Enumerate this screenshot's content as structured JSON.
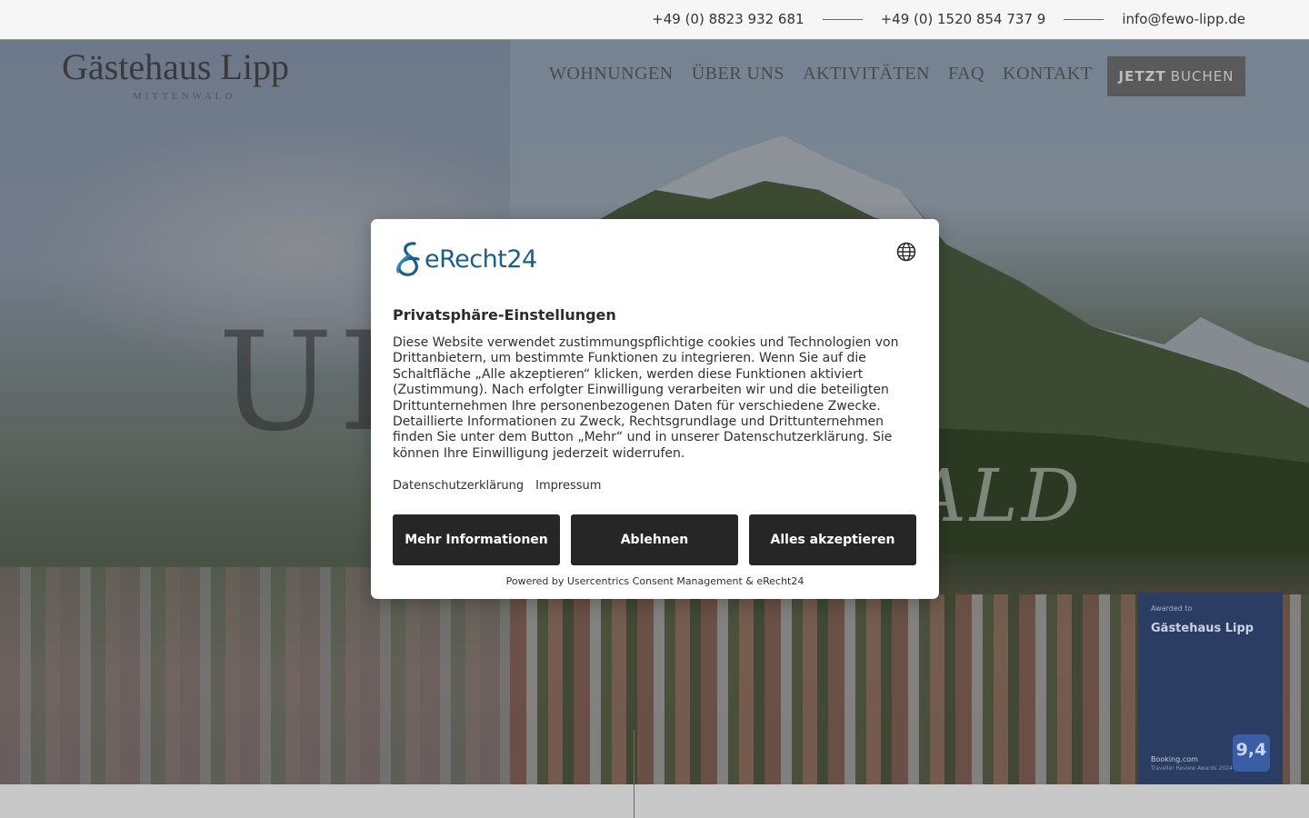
{
  "topbar": {
    "phone1": "+49 (0) 8823 932 681",
    "phone2": "+49 (0) 1520 854 737 9",
    "email": "info@fewo-lipp.de"
  },
  "header": {
    "logo": "Gästehaus Lipp",
    "logo_sub": "MITTENWALD",
    "nav": [
      "WOHNUNGEN",
      "ÜBER UNS",
      "AKTIVITÄTEN",
      "FAQ",
      "KONTAKT"
    ],
    "book_strong": "JETZT",
    "book_rest": "BUCHEN"
  },
  "hero": {
    "left_text": "UL",
    "right_text": "ALD"
  },
  "award": {
    "awarded_to": "Awarded to",
    "name": "Gästehaus Lipp",
    "booking": "Booking.com",
    "subtitle": "Traveller Review Awards 2024",
    "score": "9,4"
  },
  "consent": {
    "brand": "eRecht24",
    "title": "Privatsphäre-Einstellungen",
    "description": "Diese Website verwendet zustimmungspflichtige cookies und Technologien von Drittanbietern, um bestimmte Funktionen zu integrieren. Wenn Sie auf die Schaltfläche „Alle akzeptieren“ klicken, werden diese Funktionen aktiviert (Zustimmung). Nach erfolgter Einwilligung verarbeiten wir und die beteiligten Drittunternehmen Ihre personenbezogenen Daten für verschiedene Zwecke. Detaillierte Informationen zu Zweck, Rechtsgrundlage und Drittunternehmen finden Sie unter dem Button „Mehr“ und in unserer Datenschutzerklärung. Sie können Ihre Einwilligung jederzeit widerrufen.",
    "link_privacy": "Datenschutzerklärung",
    "link_imprint": "Impressum",
    "btn_more": "Mehr Informationen",
    "btn_deny": "Ablehnen",
    "btn_accept": "Alles akzeptieren",
    "powered": "Powered by Usercentrics Consent Management & eRecht24"
  },
  "colors": {
    "button_bg": "#262626",
    "brand_blue": "#1a5e8a",
    "award_bg": "#2b3d63"
  }
}
